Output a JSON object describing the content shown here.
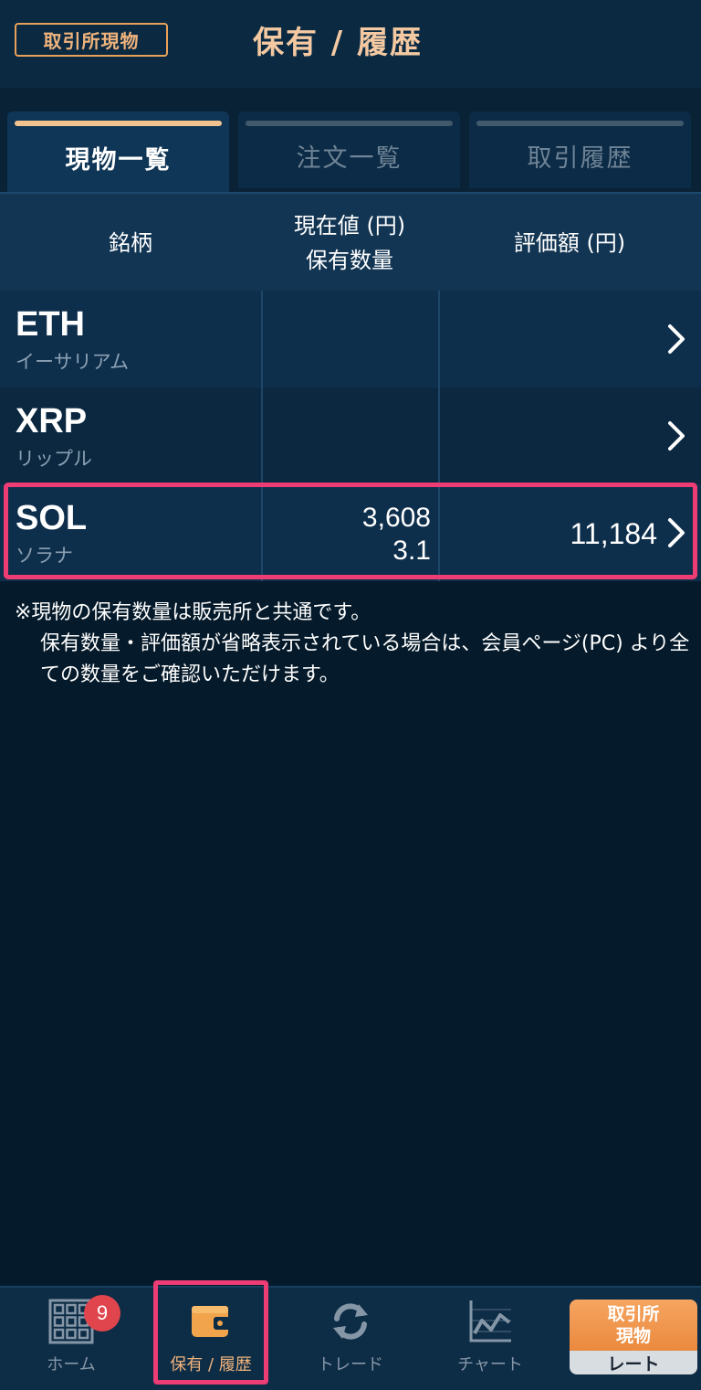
{
  "header": {
    "mode_badge": "取引所現物",
    "title": "保有 / 履歴"
  },
  "tabs": [
    {
      "label": "現物一覧",
      "active": true
    },
    {
      "label": "注文一覧",
      "active": false
    },
    {
      "label": "取引履歴",
      "active": false
    }
  ],
  "columns": {
    "symbol": "銘柄",
    "price_line1": "現在値 (円)",
    "price_line2": "保有数量",
    "valuation": "評価額 (円)"
  },
  "rows": [
    {
      "symbol": "ETH",
      "name": "イーサリアム",
      "price": "",
      "qty": "",
      "valuation": ""
    },
    {
      "symbol": "XRP",
      "name": "リップル",
      "price": "",
      "qty": "",
      "valuation": ""
    },
    {
      "symbol": "SOL",
      "name": "ソラナ",
      "price": "3,608",
      "qty": "3.1",
      "valuation": "11,184"
    }
  ],
  "note": {
    "line1": "※現物の保有数量は販売所と共通です。",
    "line2": "保有数量・評価額が省略表示されている場合は、会員ページ(PC) より全ての数量をご確認いただけます。"
  },
  "nav": {
    "home": "ホーム",
    "home_badge": "9",
    "holdings": "保有 / 履歴",
    "trade": "トレード",
    "chart": "チャート",
    "rate_top1": "取引所",
    "rate_top2": "現物",
    "rate_bottom": "レート"
  },
  "colors": {
    "accent": "#f0b37c",
    "highlight": "#ee3c75",
    "background": "#051a2a"
  }
}
